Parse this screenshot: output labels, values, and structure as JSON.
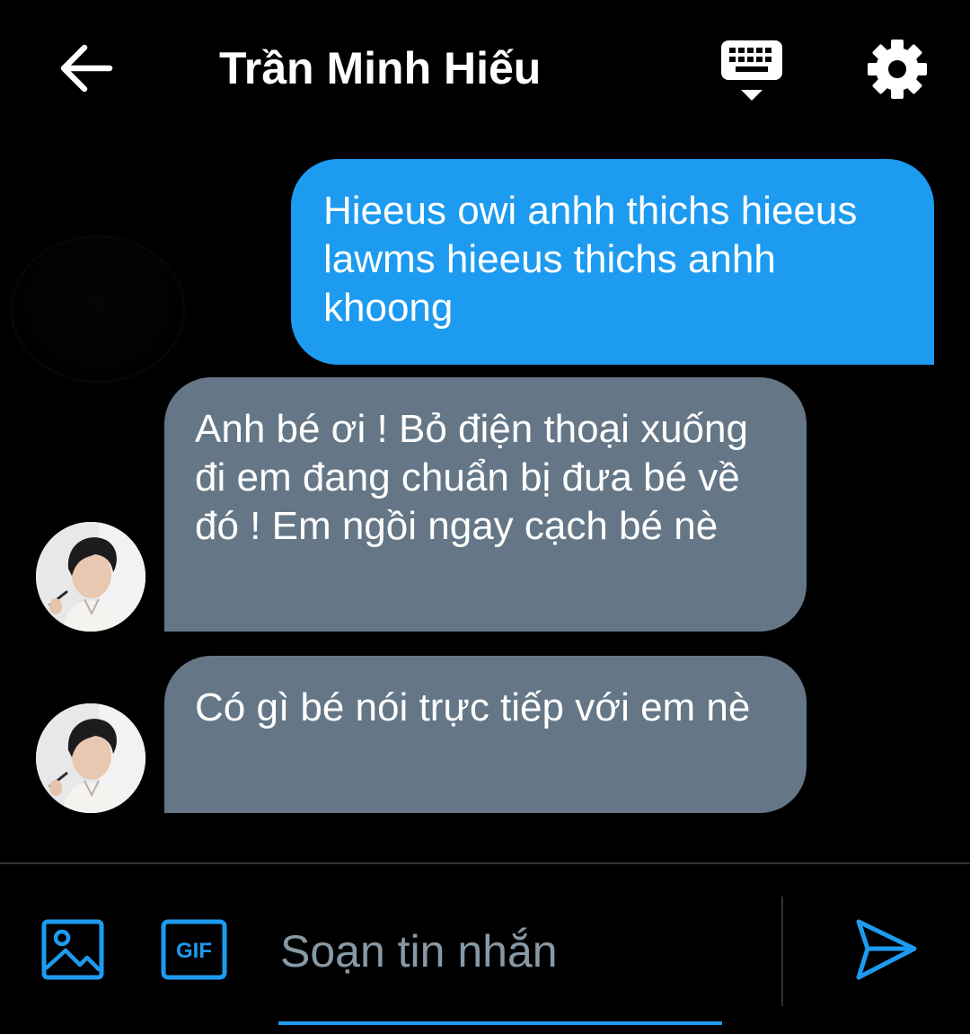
{
  "header": {
    "title": "Trần Minh Hiếu"
  },
  "messages": [
    {
      "direction": "sent",
      "text": "Hieeus owi anhh thichs hieeus lawms hieeus thichs anhh khoong"
    },
    {
      "direction": "received",
      "text": "Anh bé ơi ! Bỏ điện thoại xuống đi em đang chuẩn bị đưa bé về đó ! Em ngồi ngay cạch bé nè"
    },
    {
      "direction": "received",
      "text": "Có gì bé nói trực tiếp với em nè"
    }
  ],
  "composer": {
    "placeholder": "Soạn tin nhắn",
    "gif_label": "GIF"
  },
  "colors": {
    "background": "#000000",
    "sent_bubble": "#1d9bf0",
    "received_bubble": "#657786",
    "accent": "#1d9bf0",
    "placeholder": "#8899a6"
  },
  "icons": {
    "back": "back-arrow-icon",
    "keyboard": "keyboard-icon",
    "settings": "gear-icon",
    "image": "image-icon",
    "gif": "gif-icon",
    "send": "send-icon"
  }
}
